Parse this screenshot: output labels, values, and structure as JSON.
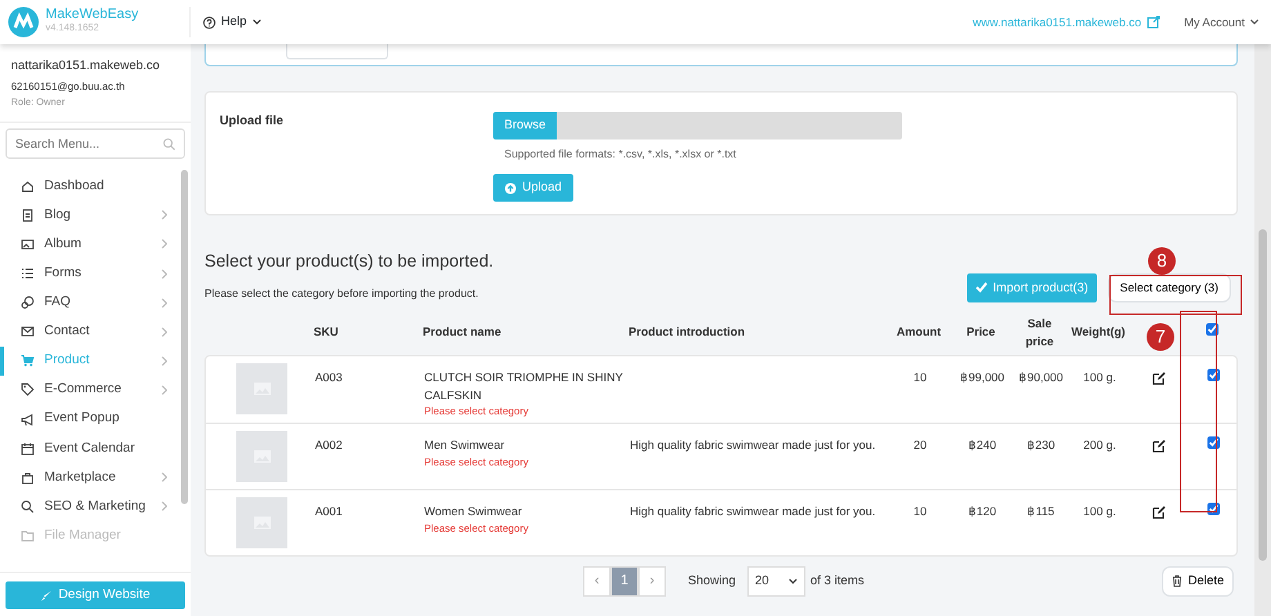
{
  "brand": {
    "name": "MakeWebEasy",
    "version": "v4.148.1652"
  },
  "topbar": {
    "help": "Help",
    "site_link": "www.nattarika0151.makeweb.co",
    "account": "My Account"
  },
  "user": {
    "site": "nattarika0151.makeweb.co",
    "email": "62160151@go.buu.ac.th",
    "role": "Role: Owner"
  },
  "sidebar": {
    "search": {
      "placeholder": "Search Menu..."
    },
    "items": [
      {
        "label": "Dashboad",
        "has_submenu": false,
        "selected": false,
        "disabled": false
      },
      {
        "label": "Blog",
        "has_submenu": true,
        "selected": false,
        "disabled": false
      },
      {
        "label": "Album",
        "has_submenu": true,
        "selected": false,
        "disabled": false
      },
      {
        "label": "Forms",
        "has_submenu": true,
        "selected": false,
        "disabled": false
      },
      {
        "label": "FAQ",
        "has_submenu": true,
        "selected": false,
        "disabled": false
      },
      {
        "label": "Contact",
        "has_submenu": true,
        "selected": false,
        "disabled": false
      },
      {
        "label": "Product",
        "has_submenu": true,
        "selected": true,
        "disabled": false
      },
      {
        "label": "E-Commerce",
        "has_submenu": true,
        "selected": false,
        "disabled": false
      },
      {
        "label": "Event Popup",
        "has_submenu": false,
        "selected": false,
        "disabled": false
      },
      {
        "label": "Event Calendar",
        "has_submenu": false,
        "selected": false,
        "disabled": false
      },
      {
        "label": "Marketplace",
        "has_submenu": true,
        "selected": false,
        "disabled": false
      },
      {
        "label": "SEO & Marketing",
        "has_submenu": true,
        "selected": false,
        "disabled": false
      },
      {
        "label": "File Manager",
        "has_submenu": false,
        "selected": false,
        "disabled": true
      }
    ],
    "design_button": "Design Website"
  },
  "upload": {
    "label": "Upload file",
    "browse": "Browse",
    "formats": "Supported file formats: *.csv, *.xls, *.xlsx or *.txt",
    "button": "Upload"
  },
  "import": {
    "title": "Select your product(s) to be imported.",
    "subtitle": "Please select the category before importing the product.",
    "import_button": "Import product(3)",
    "category_button": "Select category (3)"
  },
  "table": {
    "columns": [
      "SKU",
      "Product name",
      "Product introduction",
      "Amount",
      "Price",
      "Sale price",
      "Weight(g)"
    ],
    "all_checked": true,
    "rows": [
      {
        "sku": "A003",
        "name": "CLUTCH SOIR TRIOMPHE IN SHINY CALFSKIN",
        "warning": "Please select category",
        "introduction": "",
        "amount": "10",
        "price": "฿99,000",
        "sale_price": "฿90,000",
        "weight": "100 g.",
        "checked": true
      },
      {
        "sku": "A002",
        "name": "Men Swimwear",
        "warning": "Please select category",
        "introduction": "High quality fabric swimwear made just for you.",
        "amount": "20",
        "price": "฿240",
        "sale_price": "฿230",
        "weight": "200 g.",
        "checked": true
      },
      {
        "sku": "A001",
        "name": "Women Swimwear",
        "warning": "Please select category",
        "introduction": "High quality fabric swimwear made just for you.",
        "amount": "10",
        "price": "฿120",
        "sale_price": "฿115",
        "weight": "100 g.",
        "checked": true
      }
    ]
  },
  "pagination": {
    "prev": "‹",
    "pages": [
      {
        "label": "1",
        "selected": true
      }
    ],
    "next": "›",
    "showing": "Showing",
    "per_page": "20",
    "total": "of 3 items",
    "delete": "Delete"
  },
  "annotations": [
    {
      "number": "8"
    },
    {
      "number": "7"
    }
  ]
}
